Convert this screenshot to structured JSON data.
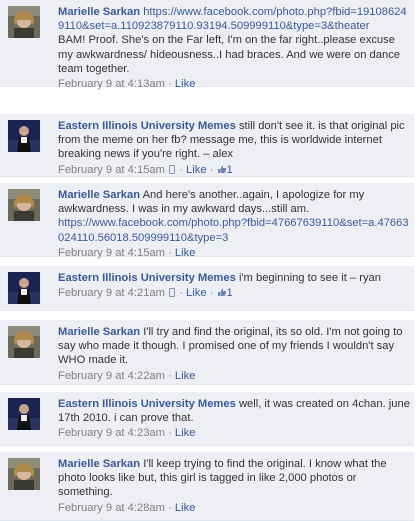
{
  "comments": [
    {
      "author": "Marielle Sarkan",
      "avatar": "marielle-avatar",
      "link": "https://www.facebook.com/photo.php?fbid=191086249110&set=a.110923879110.93194.509999110&type=3&theater",
      "text": "BAM! Proof. She's on the Far left, I'm on the far right..please excuse my awkwardness/ hideousness..I had braces. And we were on dance team together.",
      "time": "February 9 at 4:13am",
      "like": "Like",
      "likes": ""
    },
    {
      "author": "Eastern Illinois University Memes",
      "avatar": "eiu-avatar",
      "link": "",
      "text": "still don't see it. is that original pic from the meme on her fb? message me, this is worldwide internet breaking news if you're right. – alex",
      "time": "February 9 at 4:15am",
      "like": "Like",
      "likes": "1"
    },
    {
      "author": "Marielle Sarkan",
      "avatar": "marielle-avatar",
      "text_before": "And here's another..again, I apologize for my awkwardness. I was in my awkward days...still am.",
      "link": "https://www.facebook.com/photo.php?fbid=47667639110&set=a.47663024110.56018.509999110&type=3",
      "time": "February 9 at 4:15am",
      "like": "Like",
      "likes": ""
    },
    {
      "author": "Eastern Illinois University Memes",
      "avatar": "eiu-avatar",
      "text": "i'm beginning to see it – ryan",
      "time": "February 9 at 4:21am",
      "like": "Like",
      "likes": "1"
    },
    {
      "author": "Marielle Sarkan",
      "avatar": "marielle-avatar",
      "text": "I'll try and find the original, its so old. I'm not going to say who made it though. I promised one of my friends I wouldn't say WHO made it.",
      "time": "February 9 at 4:22am",
      "like": "Like",
      "likes": ""
    },
    {
      "author": "Eastern Illinois University Memes",
      "avatar": "eiu-avatar",
      "text": "well, it was created on 4chan. june 17th 2010. i can prove that.",
      "time": "February 9 at 4:23am",
      "like": "Like",
      "likes": ""
    },
    {
      "author": "Marielle Sarkan",
      "avatar": "marielle-avatar",
      "text": "I'll keep trying to find the original. I know what the photo looks like but, this girl is tagged in like 2,000 photos or something.",
      "time": "February 9 at 4:28am",
      "like": "Like",
      "likes": ""
    }
  ],
  "colors": {
    "background": "#edeff4",
    "link": "#3b5998",
    "meta": "#808080",
    "text": "#333333"
  }
}
